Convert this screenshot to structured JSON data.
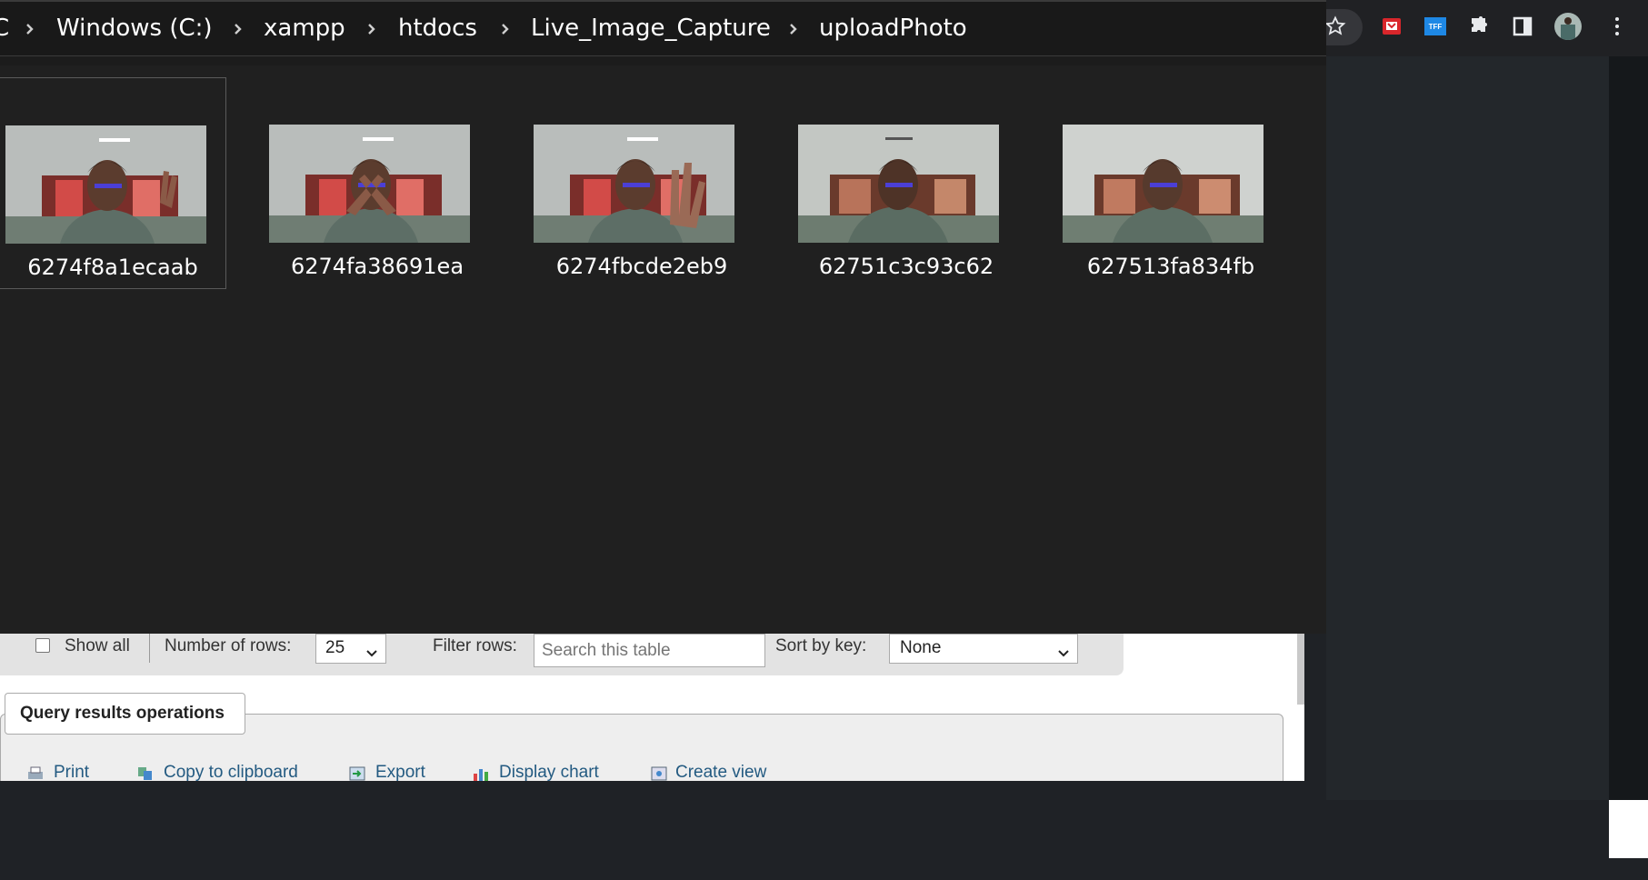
{
  "explorer": {
    "breadcrumb": {
      "partial": "C",
      "items": [
        "Windows (C:)",
        "xampp",
        "htdocs",
        "Live_Image_Capture",
        "uploadPhoto"
      ]
    },
    "files": [
      {
        "name": "6274f8a1ecaab",
        "selected": true
      },
      {
        "name": "6274fa38691ea",
        "selected": false
      },
      {
        "name": "6274fbcde2eb9",
        "selected": false
      },
      {
        "name": "62751c3c93c62",
        "selected": false
      },
      {
        "name": "627513fa834fb",
        "selected": false
      }
    ]
  },
  "browser": {
    "extensions": [
      "star-icon",
      "pdf-extension-icon",
      "tff-extension-icon",
      "puzzle-extension-icon",
      "side-panel-icon",
      "profile-avatar",
      "kebab-menu-icon"
    ],
    "tff_label": "TFF"
  },
  "pma": {
    "show_all_label": "Show all",
    "rows_label": "Number of rows:",
    "rows_value": "25",
    "filter_label": "Filter rows:",
    "filter_placeholder": "Search this table",
    "sort_label": "Sort by key:",
    "sort_value": "None",
    "operations_legend": "Query results operations",
    "operations": [
      "Print",
      "Copy to clipboard",
      "Export",
      "Display chart",
      "Create view"
    ]
  },
  "colors": {
    "explorer_bg": "#202020",
    "addressbar_bg": "#191919",
    "link": "#235a81"
  }
}
